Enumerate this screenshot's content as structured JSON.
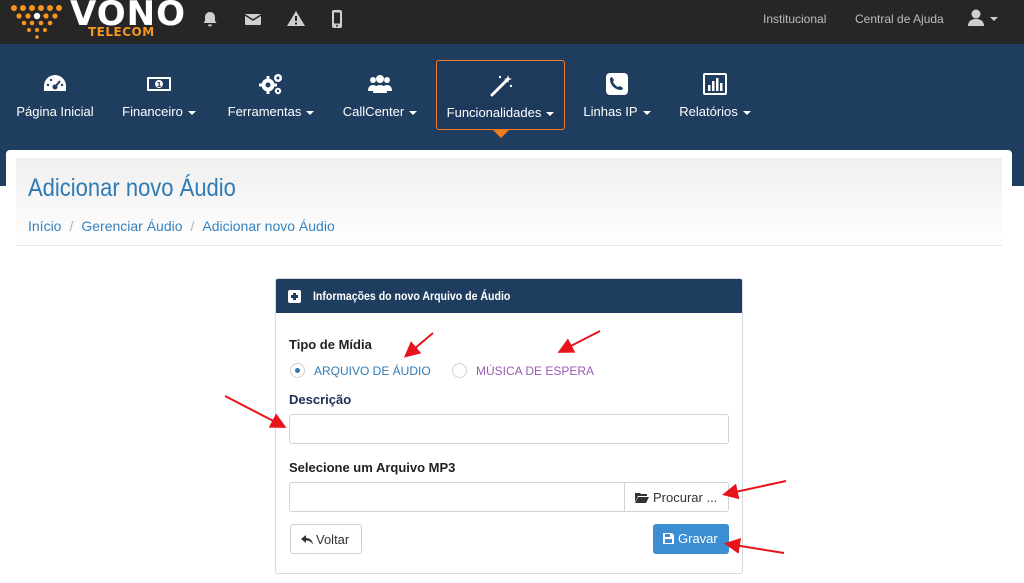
{
  "brand": {
    "name": "VONO",
    "sub": "TELECOM",
    "accent": "#f7941d"
  },
  "topbar": {
    "icons": [
      "bell-icon",
      "envelope-icon",
      "warning-icon",
      "mobile-icon"
    ],
    "links": [
      "Institucional",
      "Central de Ajuda"
    ],
    "user_icon": "user-icon"
  },
  "nav": {
    "items": [
      {
        "label": "Página Inicial",
        "icon": "dashboard-icon",
        "dropdown": false
      },
      {
        "label": "Financeiro",
        "icon": "money-icon",
        "dropdown": true
      },
      {
        "label": "Ferramentas",
        "icon": "cogs-icon",
        "dropdown": true
      },
      {
        "label": "CallCenter",
        "icon": "users-icon",
        "dropdown": true
      },
      {
        "label": "Funcionalidades",
        "icon": "magic-wand-icon",
        "dropdown": true,
        "active": true
      },
      {
        "label": "Linhas IP",
        "icon": "phone-icon",
        "dropdown": true
      },
      {
        "label": "Relatórios",
        "icon": "bar-chart-icon",
        "dropdown": true
      }
    ],
    "bg_color": "#1f3d5f",
    "active_border_color": "#f47c20"
  },
  "page": {
    "title": "Adicionar novo Áudio",
    "breadcrumb": [
      "Início",
      "Gerenciar Áudio",
      "Adicionar novo Áudio"
    ]
  },
  "form": {
    "header": "Informações do novo Arquivo de Áudio",
    "media_type_label": "Tipo de Mídia",
    "options": [
      {
        "label": "ARQUIVO DE ÁUDIO",
        "checked": true,
        "color": "#2f7ab3"
      },
      {
        "label": "MÚSICA DE ESPERA",
        "checked": false,
        "color": "#9b59b6"
      }
    ],
    "description_label": "Descrição",
    "description_value": "",
    "file_label": "Selecione um Arquivo MP3",
    "file_value": "",
    "browse_label": "Procurar ...",
    "back_label": "Voltar",
    "save_label": "Gravar"
  }
}
